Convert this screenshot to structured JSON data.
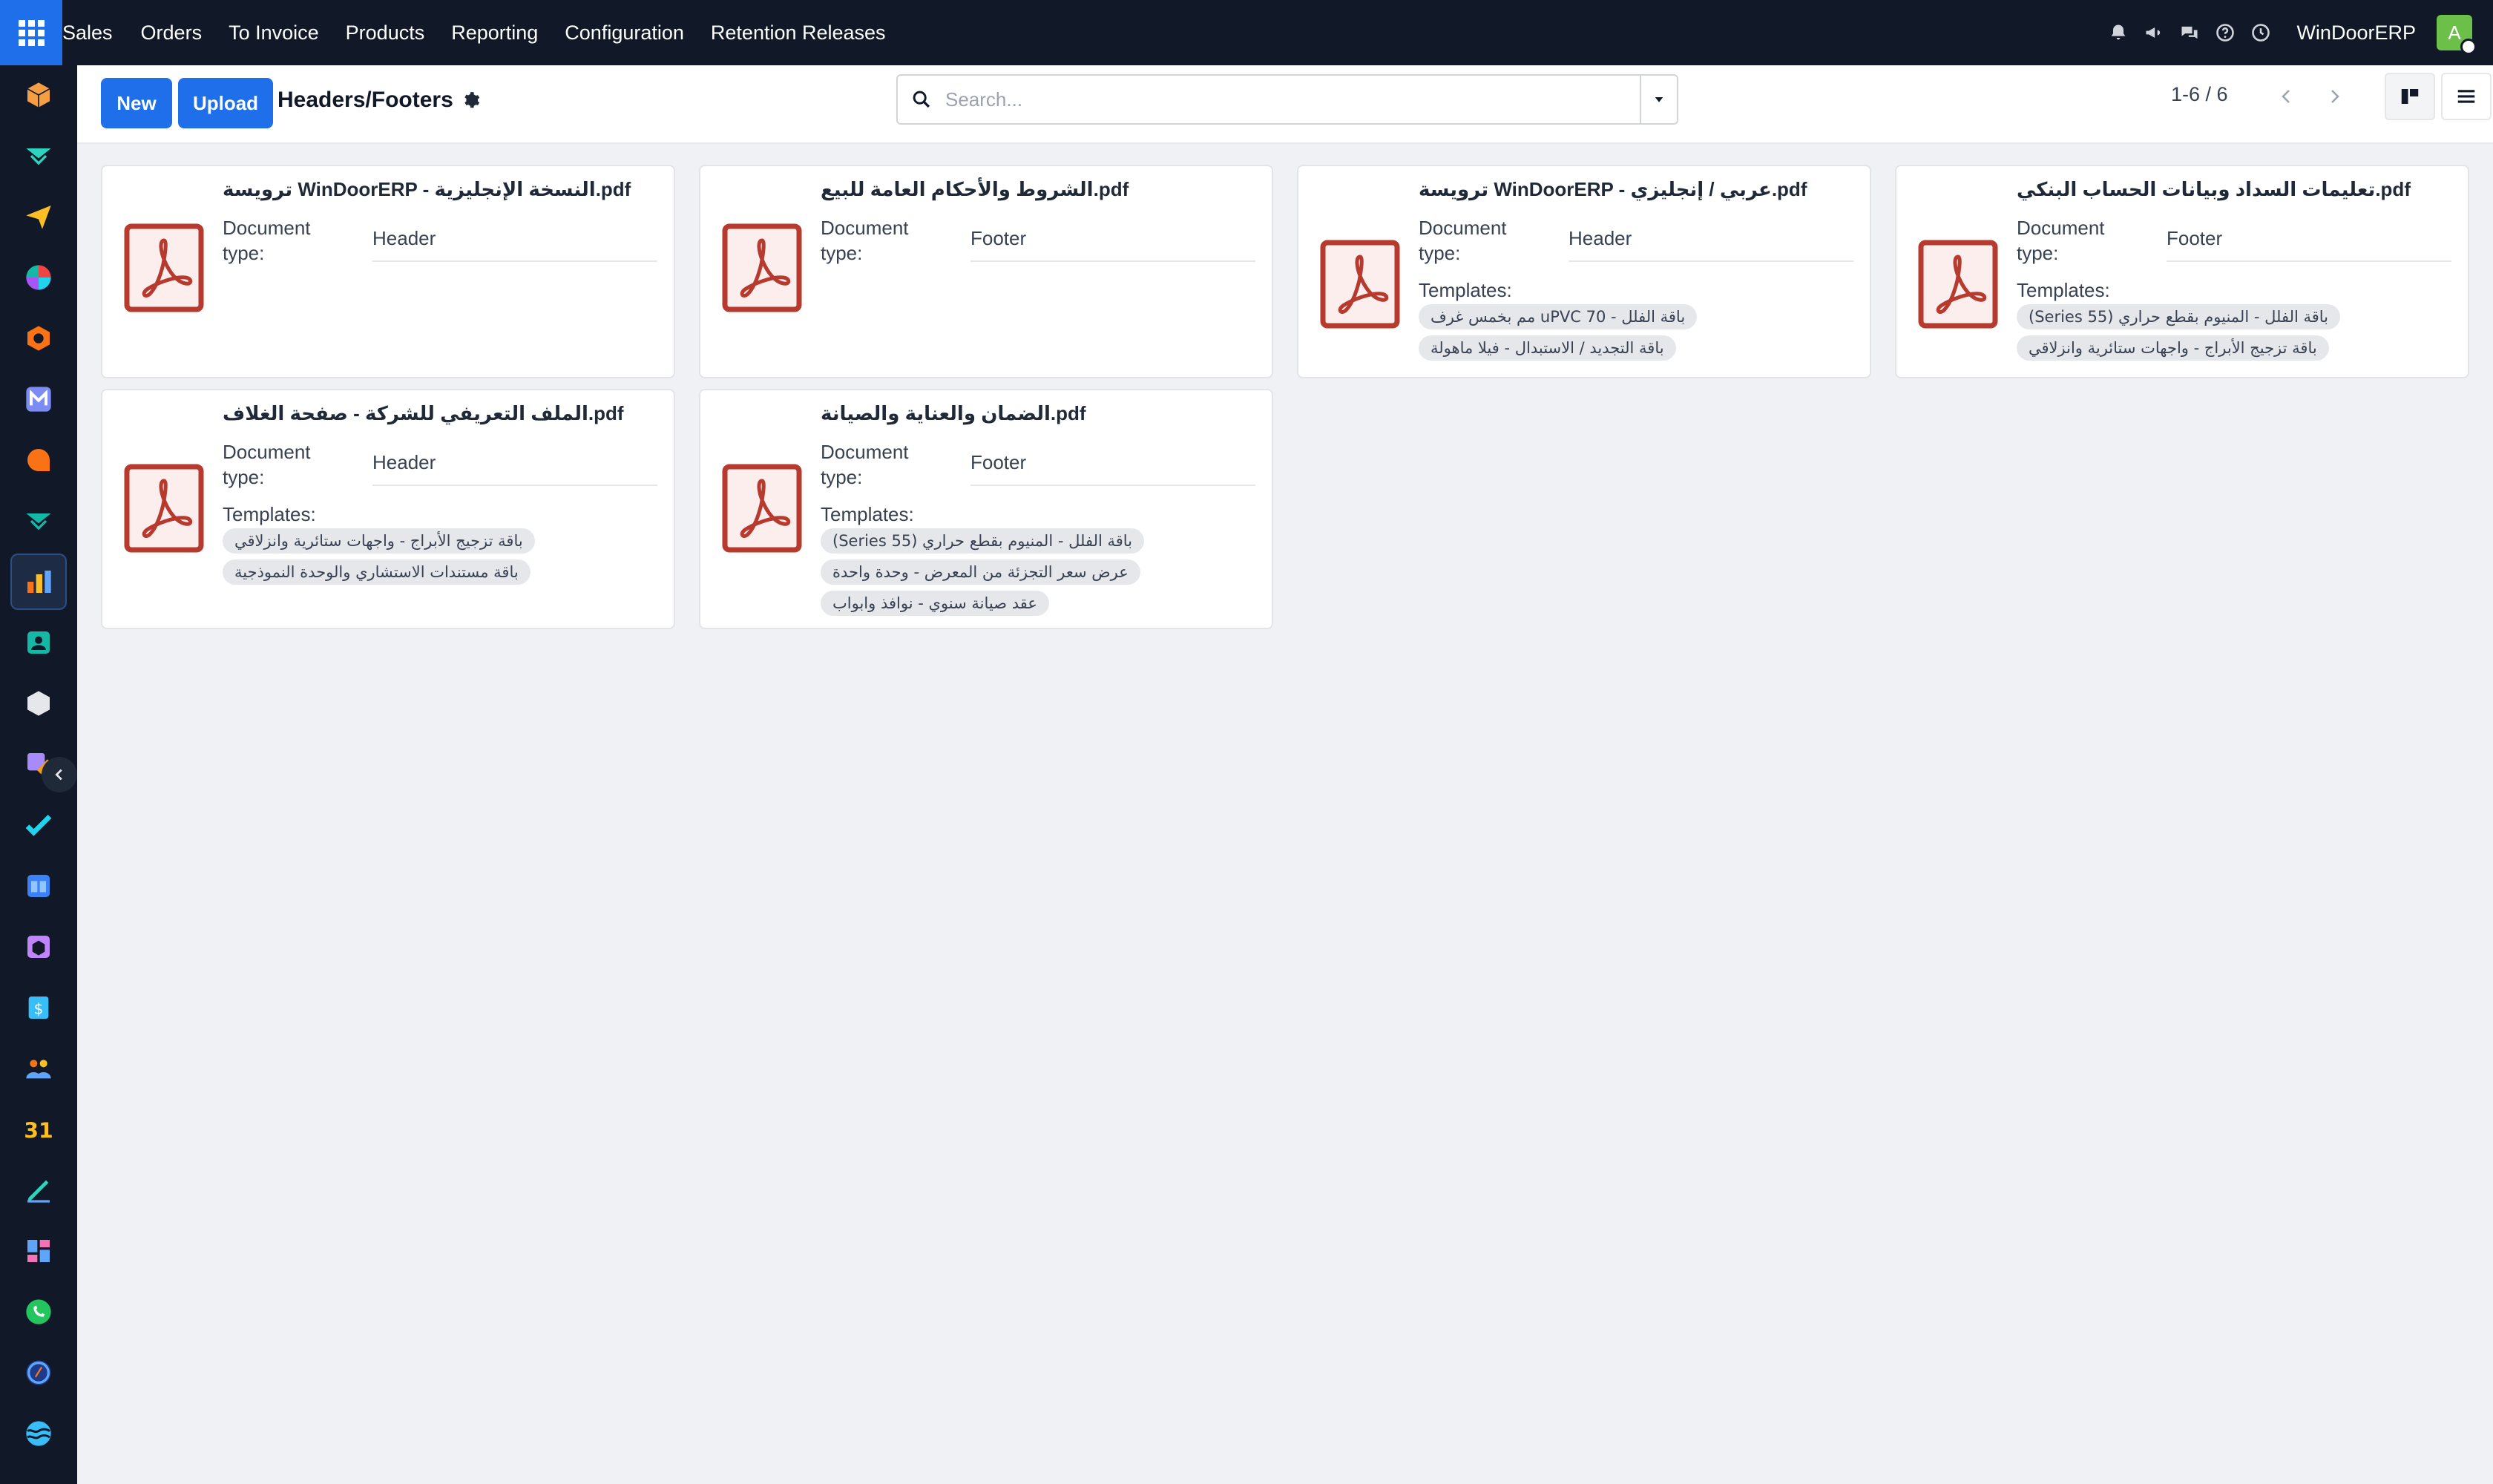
{
  "topbar": {
    "menu": [
      "Sales",
      "Orders",
      "To Invoice",
      "Products",
      "Reporting",
      "Configuration",
      "Retention Releases"
    ],
    "company": "WinDoorERP",
    "avatar_letter": "A"
  },
  "sidebar": {
    "apps": [
      {
        "icon": "cube-icon",
        "color": "#f59e42"
      },
      {
        "icon": "chevron-stack-icon",
        "color": "#2dd4bf"
      },
      {
        "icon": "paper-plane-icon",
        "color": "#fbbf24"
      },
      {
        "icon": "pie-chart-icon",
        "color": "#ef4444"
      },
      {
        "icon": "hexagon-icon",
        "color": "#f97316"
      },
      {
        "icon": "m-letter-icon",
        "color": "#7c8cf5"
      },
      {
        "icon": "chat-bubble-icon",
        "color": "#f97316"
      },
      {
        "icon": "chevron-stack-icon",
        "color": "#14b8a6"
      },
      {
        "icon": "bar-chart-icon",
        "color": "#f59e0b"
      },
      {
        "icon": "contact-card-icon",
        "color": "#14b8a6"
      },
      {
        "icon": "box-icon",
        "color": "#e5e7eb"
      },
      {
        "icon": "brush-icon",
        "color": "#f59e0b"
      },
      {
        "icon": "checkmark-icon",
        "color": "#22d3ee"
      },
      {
        "icon": "book-icon",
        "color": "#93c5fd"
      },
      {
        "icon": "package-icon",
        "color": "#c084fc"
      },
      {
        "icon": "dollar-icon",
        "color": "#38bdf8"
      },
      {
        "icon": "people-icon",
        "color": "#fbbf24"
      },
      {
        "icon": "calendar-31-icon",
        "color": "#fbbf24"
      },
      {
        "icon": "pen-icon",
        "color": "#2dd4bf"
      },
      {
        "icon": "dashboard-icon",
        "color": "#60a5fa"
      },
      {
        "icon": "whatsapp-icon",
        "color": "#22c55e"
      },
      {
        "icon": "compass-icon",
        "color": "#60a5fa"
      },
      {
        "icon": "waves-icon",
        "color": "#38bdf8"
      }
    ]
  },
  "control": {
    "new_label": "New",
    "upload_label": "Upload",
    "title": "Headers/Footers",
    "search_placeholder": "Search...",
    "pager": "1-6 / 6"
  },
  "labels": {
    "doc_type": "Document type:",
    "templates": "Templates:"
  },
  "cards": [
    {
      "title": "ترويسة WinDoorERP - النسخة الإنجليزية.pdf",
      "doc_type": "Header",
      "templates": []
    },
    {
      "title": "الشروط والأحكام العامة للبيع.pdf",
      "doc_type": "Footer",
      "templates": []
    },
    {
      "title": "ترويسة WinDoorERP - عربي / إنجليزي.pdf",
      "doc_type": "Header",
      "templates": [
        "باقة الفلل - uPVC 70 مم بخمس غرف",
        "باقة التجديد / الاستبدال - فيلا ماهولة"
      ]
    },
    {
      "title": "تعليمات السداد وبيانات الحساب البنكي.pdf",
      "doc_type": "Footer",
      "templates": [
        "باقة الفلل - المنيوم بقطع حراري (Series 55)",
        "باقة تزجيج الأبراج - واجهات ستائرية وانزلاقي"
      ]
    },
    {
      "title": "الملف التعريفي للشركة - صفحة الغلاف.pdf",
      "doc_type": "Header",
      "templates": [
        "باقة تزجيج الأبراج - واجهات ستائرية وانزلاقي",
        "باقة مستندات الاستشاري والوحدة النموذجية"
      ]
    },
    {
      "title": "الضمان والعناية والصيانة.pdf",
      "doc_type": "Footer",
      "templates": [
        "باقة الفلل - المنيوم بقطع حراري (Series 55)",
        "عرض سعر التجزئة من المعرض - وحدة واحدة",
        "عقد صيانة سنوي - نوافذ وابواب"
      ]
    }
  ]
}
